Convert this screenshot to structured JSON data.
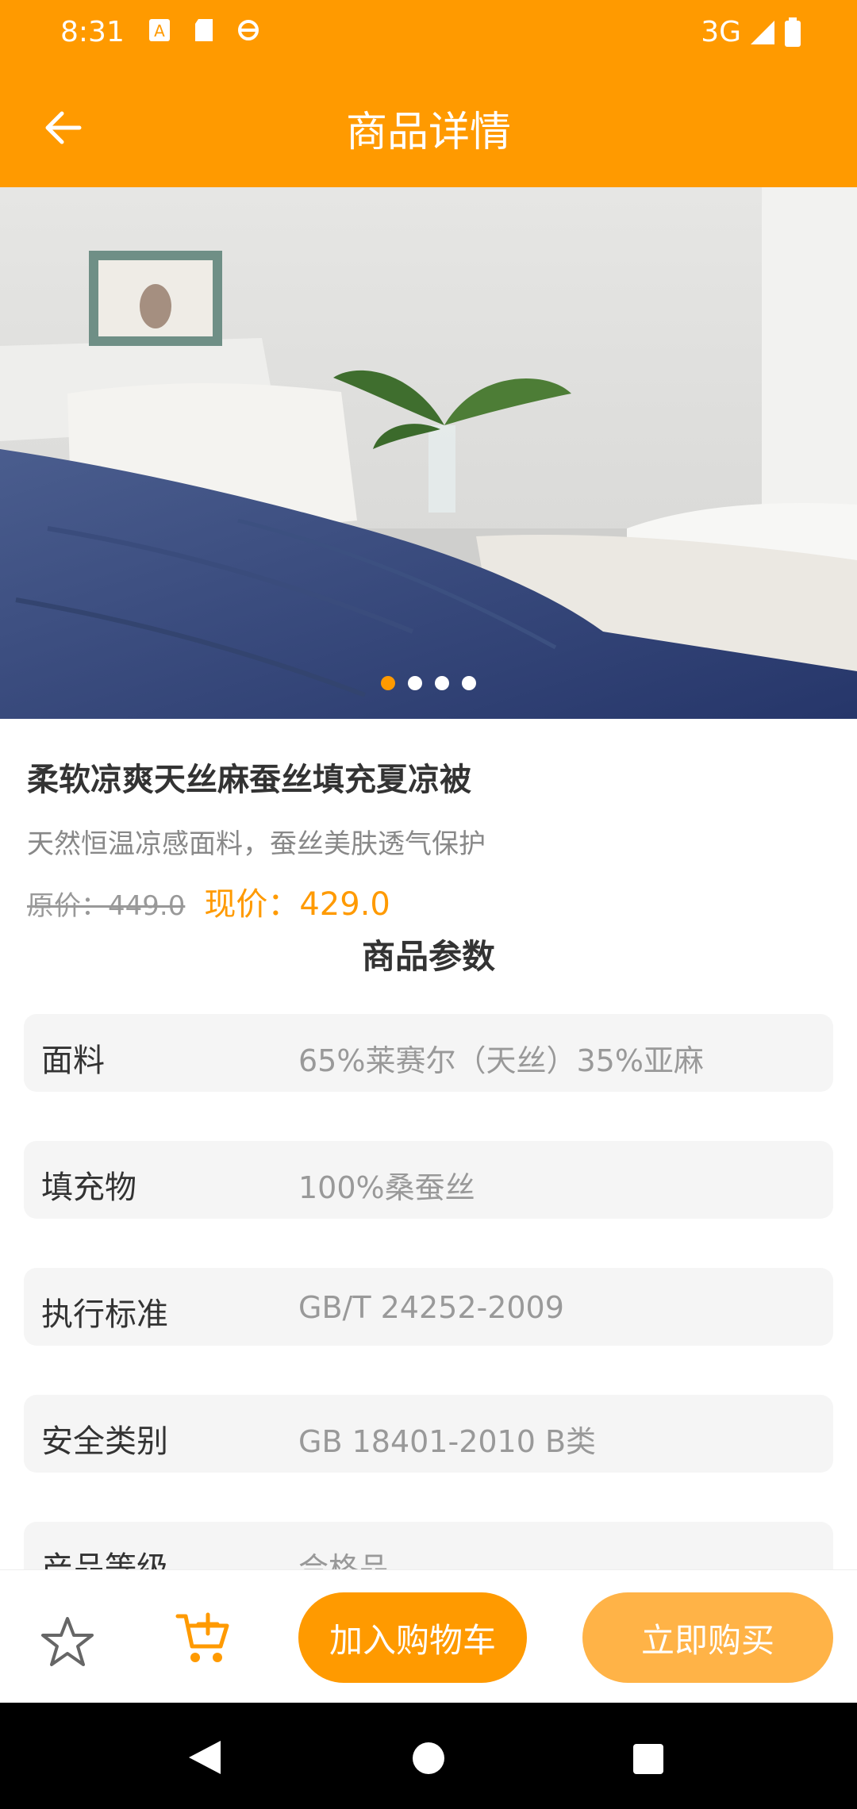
{
  "status_bar": {
    "time": "8:31",
    "network": "3G"
  },
  "app_bar": {
    "title": "商品详情"
  },
  "gallery": {
    "page_count": 4,
    "current_page": 1
  },
  "product": {
    "title": "柔软凉爽天丝麻蚕丝填充夏凉被",
    "subtitle": "天然恒温凉感面料，蚕丝美肤透气保护",
    "original_price": "原价：449.0",
    "current_price": "现价：429.0"
  },
  "params": {
    "title": "商品参数",
    "items": [
      {
        "key": "面料",
        "value": "65%莱赛尔（天丝）35%亚麻"
      },
      {
        "key": "填充物",
        "value": "100%桑蚕丝"
      },
      {
        "key": "执行标准",
        "value": "GB/T 24252-2009"
      },
      {
        "key": "安全类别",
        "value": "GB 18401-2010 B类"
      },
      {
        "key": "产品等级",
        "value": "合格品"
      }
    ]
  },
  "actions": {
    "add_to_cart": "加入购物车",
    "buy_now": "立即购买"
  },
  "colors": {
    "accent": "#FF9A00",
    "accent_light": "#FFB347"
  }
}
